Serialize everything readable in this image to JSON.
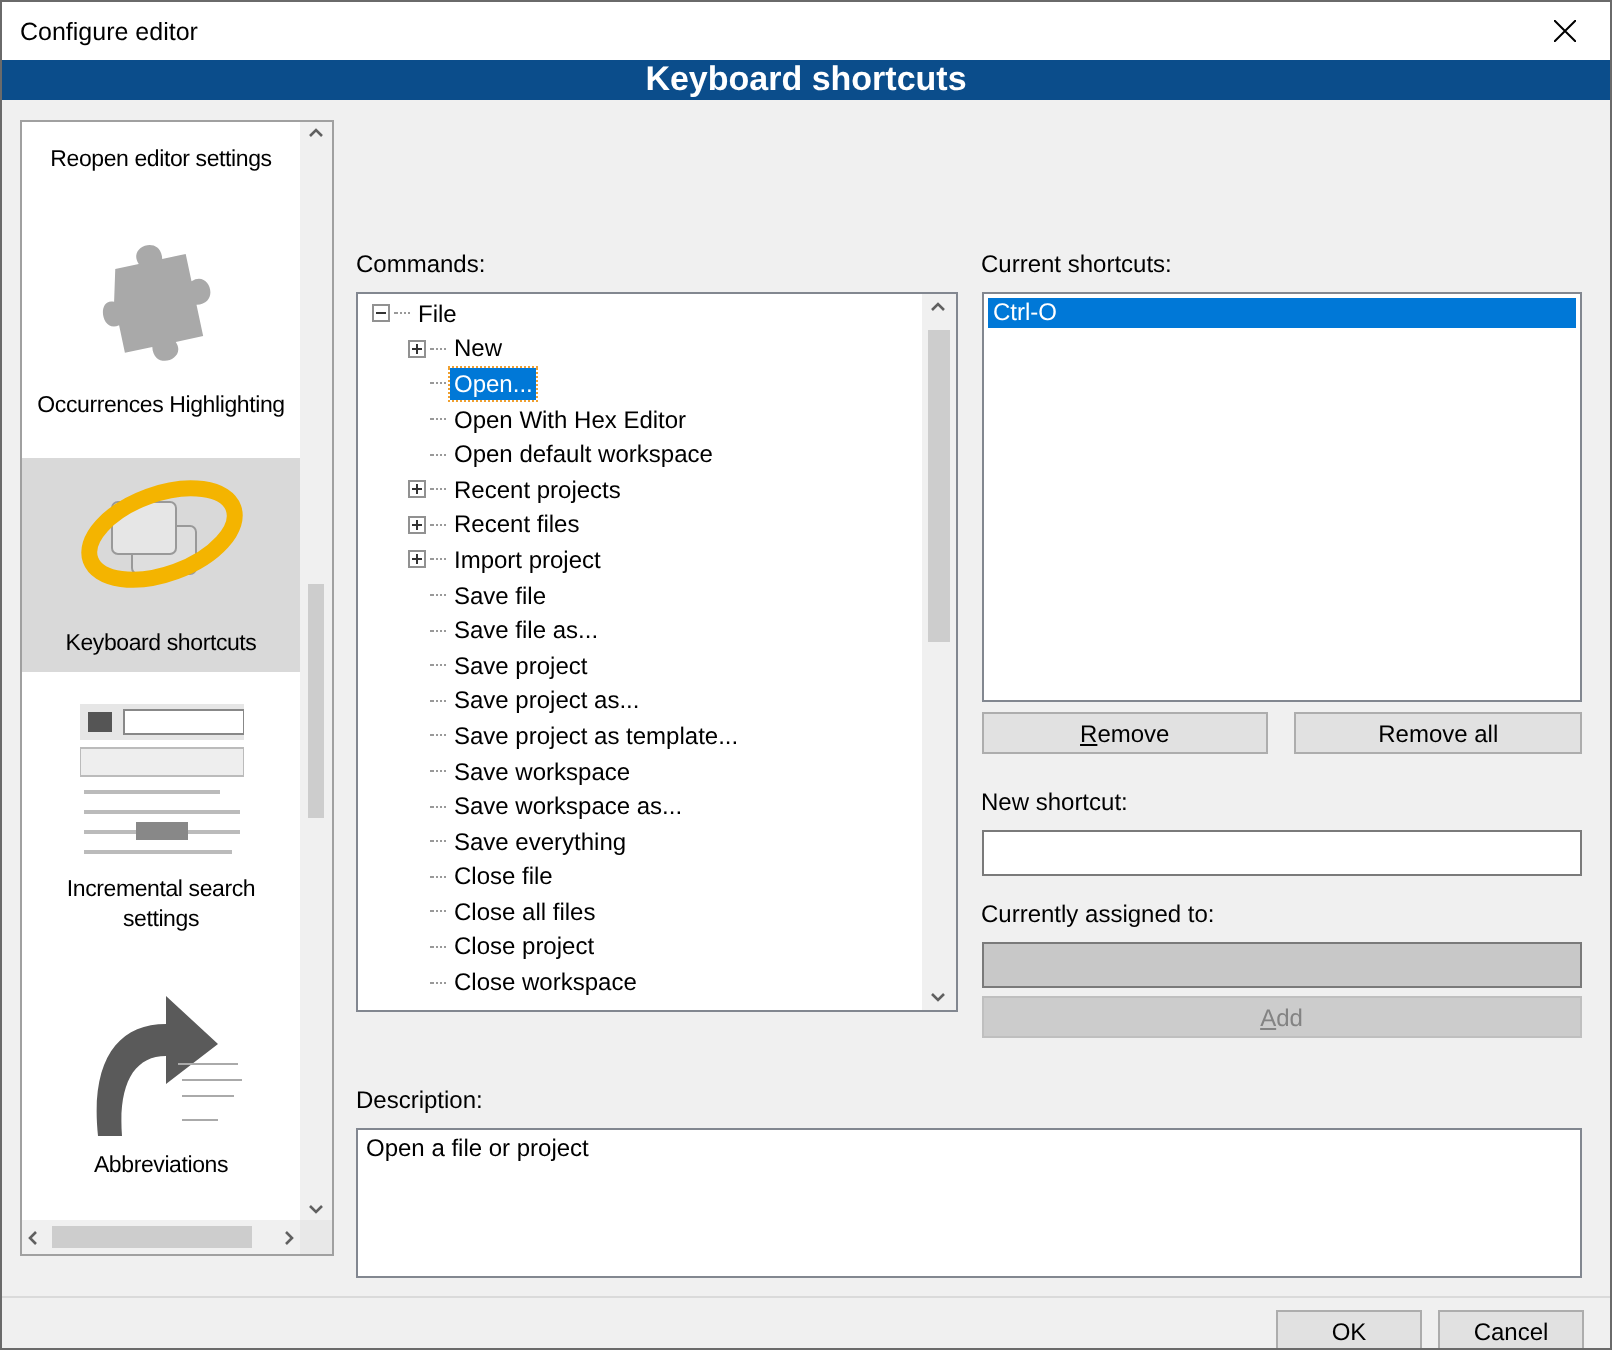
{
  "window": {
    "title": "Configure editor"
  },
  "header": {
    "title": "Keyboard shortcuts"
  },
  "sidebar": {
    "items": [
      {
        "label": "Reopen editor settings",
        "selected": false
      },
      {
        "label": "Occurrences Highlighting",
        "selected": false
      },
      {
        "label": "Keyboard shortcuts",
        "selected": true
      },
      {
        "label": "Incremental search settings",
        "selected": false
      },
      {
        "label": "Abbreviations",
        "selected": false
      }
    ]
  },
  "commands": {
    "label": "Commands:",
    "tree": [
      {
        "label": "File",
        "kind": "group",
        "expanded": true,
        "selected": false,
        "children": [
          {
            "label": "New",
            "kind": "group",
            "expanded": false,
            "selected": false
          },
          {
            "label": "Open...",
            "kind": "leaf",
            "selected": true
          },
          {
            "label": "Open With Hex Editor",
            "kind": "leaf",
            "selected": false
          },
          {
            "label": "Open default workspace",
            "kind": "leaf",
            "selected": false
          },
          {
            "label": "Recent projects",
            "kind": "group",
            "expanded": false,
            "selected": false
          },
          {
            "label": "Recent files",
            "kind": "group",
            "expanded": false,
            "selected": false
          },
          {
            "label": "Import project",
            "kind": "group",
            "expanded": false,
            "selected": false
          },
          {
            "label": "Save file",
            "kind": "leaf",
            "selected": false
          },
          {
            "label": "Save file as...",
            "kind": "leaf",
            "selected": false
          },
          {
            "label": "Save project",
            "kind": "leaf",
            "selected": false
          },
          {
            "label": "Save project as...",
            "kind": "leaf",
            "selected": false
          },
          {
            "label": "Save project as template...",
            "kind": "leaf",
            "selected": false
          },
          {
            "label": "Save workspace",
            "kind": "leaf",
            "selected": false
          },
          {
            "label": "Save workspace as...",
            "kind": "leaf",
            "selected": false
          },
          {
            "label": "Save everything",
            "kind": "leaf",
            "selected": false
          },
          {
            "label": "Close file",
            "kind": "leaf",
            "selected": false
          },
          {
            "label": "Close all files",
            "kind": "leaf",
            "selected": false
          },
          {
            "label": "Close project",
            "kind": "leaf",
            "selected": false
          },
          {
            "label": "Close workspace",
            "kind": "leaf",
            "selected": false
          }
        ]
      }
    ]
  },
  "current_shortcuts": {
    "label": "Current shortcuts:",
    "items": [
      {
        "label": "Ctrl-O",
        "selected": true
      }
    ]
  },
  "buttons_shortcuts": [
    {
      "label": "Remove",
      "underline_first": true,
      "disabled": false
    },
    {
      "label": "Remove all",
      "underline_first": false,
      "disabled": false
    }
  ],
  "new_shortcut": {
    "label": "New shortcut:"
  },
  "currently_assigned": {
    "label": "Currently assigned to:",
    "disabled": true
  },
  "add_button": {
    "label": "Add",
    "underline_first": true,
    "disabled": true
  },
  "description": {
    "label": "Description:",
    "value": "Open a file or project"
  },
  "dialog_buttons": [
    {
      "label": "OK"
    },
    {
      "label": "Cancel"
    }
  ]
}
